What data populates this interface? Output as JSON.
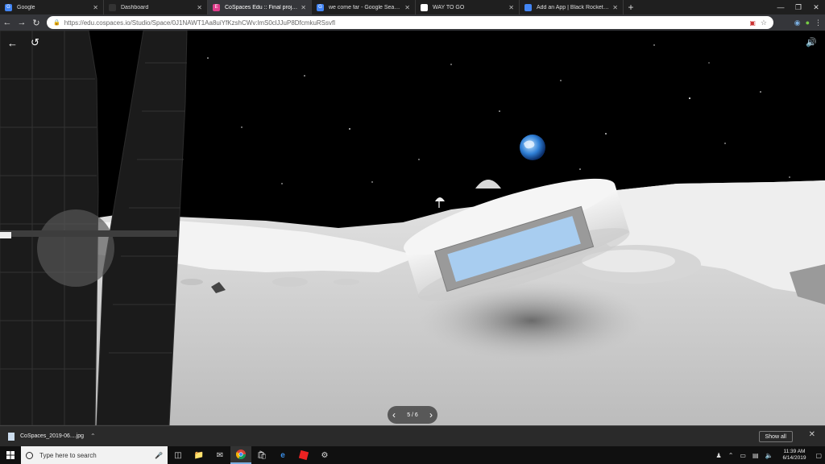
{
  "browser": {
    "tabs": [
      {
        "title": "Google",
        "favicon_color": "#4285f4",
        "favicon_char": "G",
        "active": false
      },
      {
        "title": "Dashboard",
        "favicon_color": "#333333",
        "favicon_char": "",
        "active": false
      },
      {
        "title": "CoSpaces Edu :: Final project",
        "favicon_color": "#e03c8c",
        "favicon_char": "E",
        "active": true
      },
      {
        "title": "we come far - Google Search",
        "favicon_color": "#4285f4",
        "favicon_char": "G",
        "active": false
      },
      {
        "title": "WAY TO GO",
        "favicon_color": "#ffffff",
        "favicon_char": "",
        "active": false
      },
      {
        "title": "Add an App | Black Rocket Arcade",
        "favicon_color": "#4285f4",
        "favicon_char": "",
        "active": false
      }
    ],
    "url": "https://edu.cospaces.io/Studio/Space/0J1NAWT1Aa8uiYfKzshCWv:lmS0clJJuP8DfcmkuRSsvfl"
  },
  "scene": {
    "pager_text": "5 / 6"
  },
  "downloads": {
    "file_name": "CoSpaces_2019-06....jpg",
    "show_all_label": "Show all"
  },
  "taskbar": {
    "search_placeholder": "Type here to search",
    "time": "11:39 AM",
    "date": "6/14/2019"
  },
  "colors": {
    "accent": "#7aaee0",
    "screen_blue": "#a8cdf0"
  }
}
